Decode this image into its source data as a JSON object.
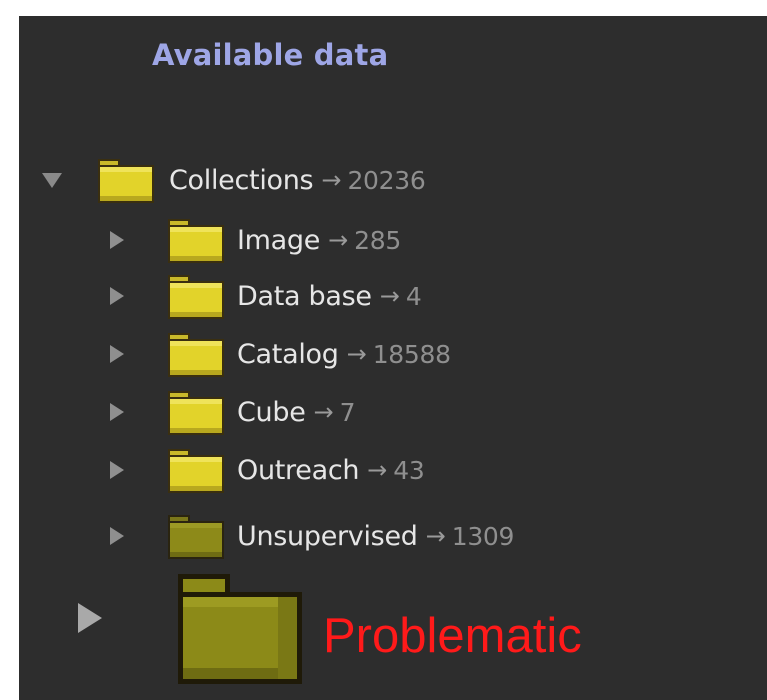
{
  "panel": {
    "title": "Available data"
  },
  "tree": {
    "root": {
      "label": "Collections",
      "arrow": "→",
      "count": "20236",
      "icon": "folder-icon",
      "expanded": true
    },
    "children": [
      {
        "label": "Image",
        "arrow": "→",
        "count": "285",
        "icon": "folder-icon"
      },
      {
        "label": "Data base",
        "arrow": "→",
        "count": "4",
        "icon": "folder-icon"
      },
      {
        "label": "Catalog",
        "arrow": "→",
        "count": "18588",
        "icon": "folder-icon"
      },
      {
        "label": "Cube",
        "arrow": "→",
        "count": "7",
        "icon": "folder-icon"
      },
      {
        "label": "Outreach",
        "arrow": "→",
        "count": "43",
        "icon": "folder-icon"
      },
      {
        "label": "Unsupervised",
        "arrow": "→",
        "count": "1309",
        "icon": "folder-icon-dim"
      }
    ]
  },
  "annotation": {
    "label": "Problematic",
    "color": "#ff1a1a",
    "icon": "folder-icon-enlarged"
  },
  "colors": {
    "background": "#2d2d2d",
    "title": "#9ea6e6",
    "label": "#e6e6e6",
    "count": "#8f8f8f",
    "folder": "#e2d32a",
    "folder_dim": "#8d8a19"
  }
}
